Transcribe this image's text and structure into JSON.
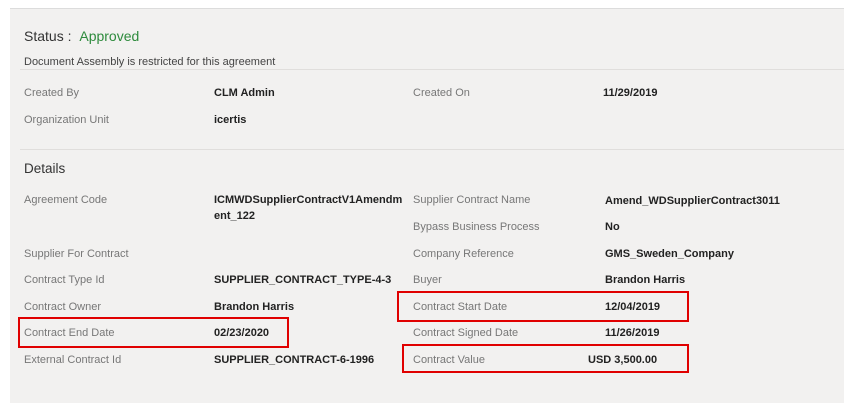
{
  "status": {
    "label": "Status :",
    "value": "Approved"
  },
  "notice": "Document Assembly is restricted for this agreement",
  "header_fields": {
    "created_by": {
      "label": "Created By",
      "value": "CLM Admin"
    },
    "created_on": {
      "label": "Created On",
      "value": "11/29/2019"
    },
    "org_unit": {
      "label": "Organization Unit",
      "value": "icertis"
    }
  },
  "details": {
    "title": "Details",
    "agreement_code": {
      "label": "Agreement Code",
      "value": "ICMWDSupplierContractV1Amendment_122"
    },
    "supplier_contract_name": {
      "label": "Supplier Contract Name",
      "value": "Amend_WDSupplierContract3011"
    },
    "bypass_business_process": {
      "label": "Bypass Business Process",
      "value": "No"
    },
    "supplier_for_contract": {
      "label": "Supplier For Contract",
      "value": ""
    },
    "company_reference": {
      "label": "Company Reference",
      "value": "GMS_Sweden_Company"
    },
    "contract_type_id": {
      "label": "Contract Type Id",
      "value": "SUPPLIER_CONTRACT_TYPE-4-3"
    },
    "buyer": {
      "label": "Buyer",
      "value": "Brandon Harris"
    },
    "contract_owner": {
      "label": "Contract Owner",
      "value": "Brandon Harris"
    },
    "contract_start_date": {
      "label": "Contract Start Date",
      "value": "12/04/2019"
    },
    "contract_end_date": {
      "label": "Contract End Date",
      "value": "02/23/2020"
    },
    "contract_signed_date": {
      "label": "Contract Signed Date",
      "value": "11/26/2019"
    },
    "external_contract_id": {
      "label": "External Contract Id",
      "value": "SUPPLIER_CONTRACT-6-1996"
    },
    "contract_value": {
      "label": "Contract Value",
      "value": "USD 3,500.00"
    }
  },
  "colors": {
    "approved": "#2e8b3d",
    "highlight": "#e00000",
    "panel_bg": "#f2f1f0"
  }
}
